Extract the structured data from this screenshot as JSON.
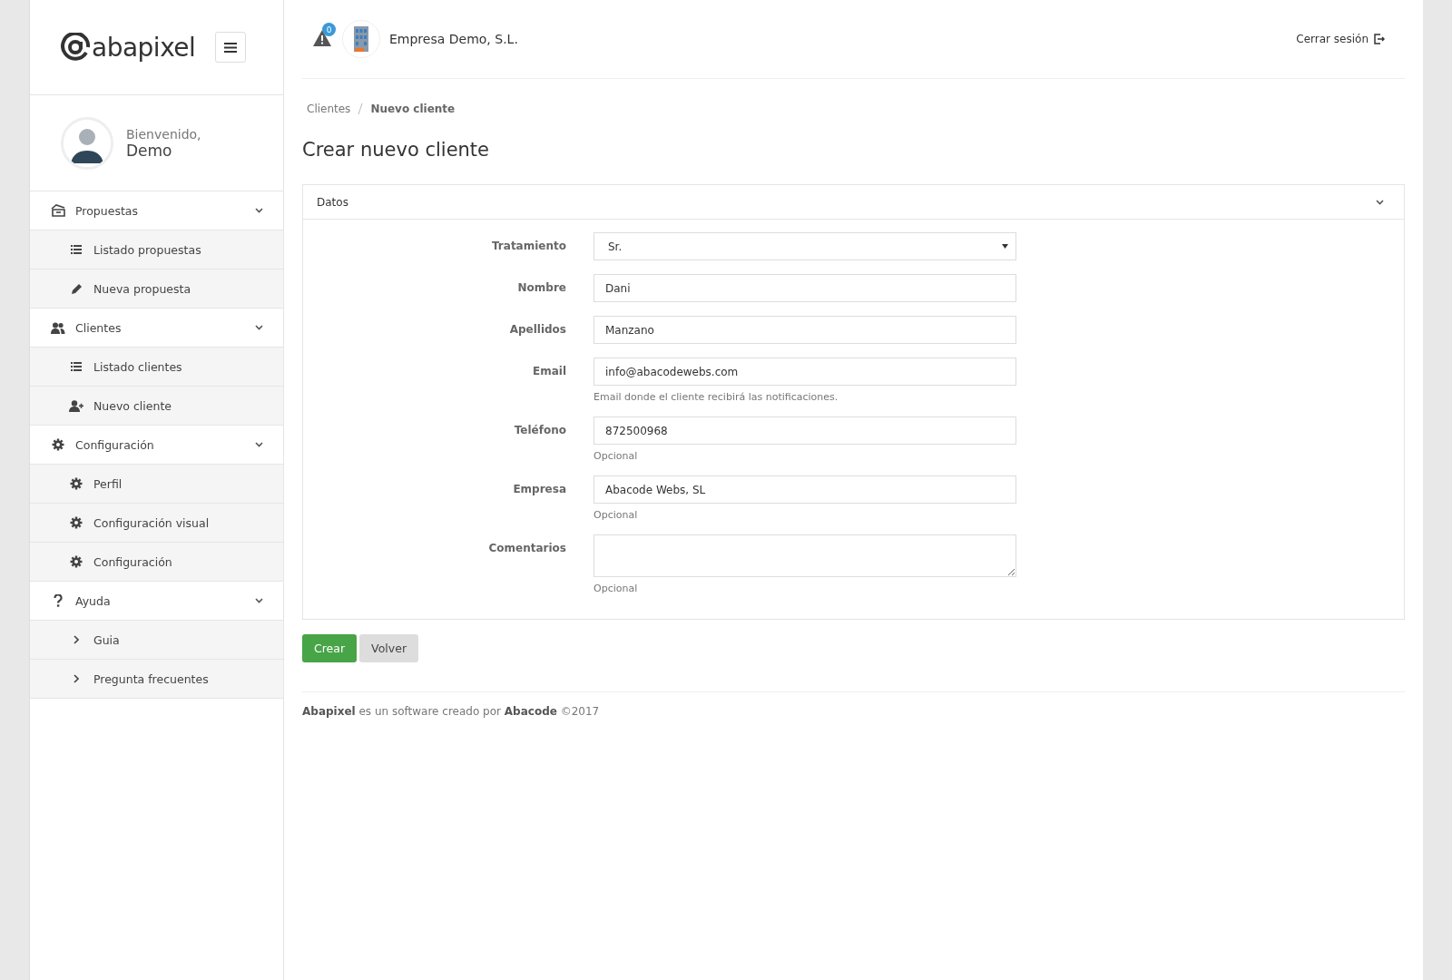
{
  "sidebar": {
    "logo": "abapixel",
    "welcome": "Bienvenido,",
    "user": "Demo",
    "menu": [
      {
        "label": "Propuestas",
        "children": [
          {
            "label": "Listado propuestas"
          },
          {
            "label": "Nueva propuesta"
          }
        ]
      },
      {
        "label": "Clientes",
        "children": [
          {
            "label": "Listado clientes"
          },
          {
            "label": "Nuevo cliente"
          }
        ]
      },
      {
        "label": "Configuración",
        "children": [
          {
            "label": "Perfil"
          },
          {
            "label": "Configuración visual"
          },
          {
            "label": "Configuración"
          }
        ]
      },
      {
        "label": "Ayuda",
        "children": [
          {
            "label": "Guia"
          },
          {
            "label": "Pregunta frecuentes"
          }
        ]
      }
    ]
  },
  "topbar": {
    "alert_count": "0",
    "company": "Empresa Demo, S.L.",
    "logout": "Cerrar sesión"
  },
  "breadcrumb": [
    "Clientes",
    "Nuevo cliente"
  ],
  "title": "Crear nuevo cliente",
  "panel": {
    "title": "Datos",
    "fields": [
      {
        "kind": "select",
        "label": "Tratamiento",
        "value": "Sr."
      },
      {
        "kind": "text",
        "label": "Nombre",
        "value": "Dani"
      },
      {
        "kind": "text",
        "label": "Apellidos",
        "value": "Manzano"
      },
      {
        "kind": "text",
        "label": "Email",
        "value": "info@abacodewebs.com",
        "help": "Email donde el cliente recibirá las notificaciones."
      },
      {
        "kind": "text",
        "label": "Teléfono",
        "value": "872500968",
        "help": "Opcional"
      },
      {
        "kind": "text",
        "label": "Empresa",
        "value": "Abacode Webs, SL",
        "help": "Opcional"
      },
      {
        "kind": "textarea",
        "label": "Comentarios",
        "help": "Opcional"
      }
    ]
  },
  "buttons": [
    {
      "label": "Crear",
      "kind": "primary"
    },
    {
      "label": "Volver",
      "kind": "default"
    }
  ],
  "footer": "**Abapixel** es un software creado por **Abacode** ©2017"
}
